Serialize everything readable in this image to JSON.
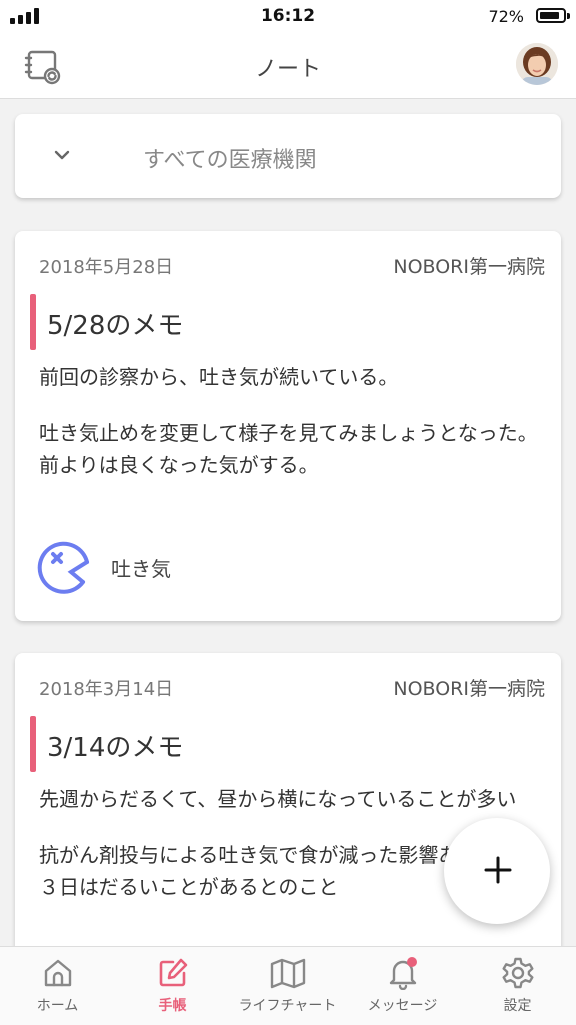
{
  "status_bar": {
    "time": "16:12",
    "battery": "72%"
  },
  "header": {
    "title": "ノート"
  },
  "filter": {
    "label": "すべての医療機関"
  },
  "notes": [
    {
      "date": "2018年5月28日",
      "hospital": "NOBORI第一病院",
      "title": "5/28のメモ",
      "paragraphs": [
        "前回の診察から、吐き気が続いている。",
        "吐き気止めを変更して様子を見てみましょうとなった。",
        "前よりは良くなった気がする。"
      ],
      "symptom": "吐き気"
    },
    {
      "date": "2018年3月14日",
      "hospital": "NOBORI第一病院",
      "title": "3/14のメモ",
      "paragraphs": [
        "先週からだるくて、昼から横になっていることが多い",
        "抗がん剤投与による吐き気で食が減った影響あり。2，３日はだるいことがあるとのこと"
      ]
    }
  ],
  "tabs": [
    {
      "label": "ホーム",
      "icon": "home-icon"
    },
    {
      "label": "手帳",
      "icon": "edit-icon"
    },
    {
      "label": "ライフチャート",
      "icon": "map-icon"
    },
    {
      "label": "メッセージ",
      "icon": "bell-icon"
    },
    {
      "label": "設定",
      "icon": "gear-icon"
    }
  ],
  "active_tab": "手帳",
  "colors": {
    "accent": "#e8607a",
    "symptom_icon": "#6c7df0",
    "background": "#f2f2f2"
  }
}
